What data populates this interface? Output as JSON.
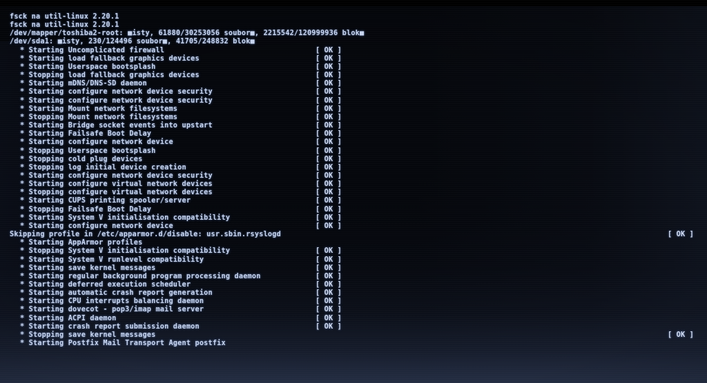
{
  "screen": {
    "kind": "linux-boot-console",
    "background_color": "#05070c",
    "text_color": "#c7d4ee",
    "status_ok_color": "#d2dcf2"
  },
  "console": {
    "lines": [
      {
        "text": "fsck na util-linux 2.20.1",
        "indent": false,
        "status": "",
        "status_pos": ""
      },
      {
        "text": "fsck na util-linux 2.20.1",
        "indent": false,
        "status": "",
        "status_pos": ""
      },
      {
        "text": "/dev/mapper/toshiba2-root: ■isty, 61880/30253056 soubor■, 2215542/120999936 blok■",
        "indent": false,
        "status": "",
        "status_pos": ""
      },
      {
        "text": "/dev/sda1: ■isty, 230/124496 soubor■, 41705/248832 blok■",
        "indent": false,
        "status": "",
        "status_pos": ""
      },
      {
        "text": "* Starting Uncomplicated firewall",
        "indent": true,
        "status": "[ OK ]",
        "status_pos": "near"
      },
      {
        "text": "* Starting load fallback graphics devices",
        "indent": true,
        "status": "[ OK ]",
        "status_pos": "near"
      },
      {
        "text": "* Starting Userspace bootsplash",
        "indent": true,
        "status": "[ OK ]",
        "status_pos": "near"
      },
      {
        "text": "* Stopping load fallback graphics devices",
        "indent": true,
        "status": "[ OK ]",
        "status_pos": "near"
      },
      {
        "text": "* Starting mDNS/DNS-SD daemon",
        "indent": true,
        "status": "[ OK ]",
        "status_pos": "near"
      },
      {
        "text": "* Starting configure network device security",
        "indent": true,
        "status": "[ OK ]",
        "status_pos": "near"
      },
      {
        "text": "* Starting configure network device security",
        "indent": true,
        "status": "[ OK ]",
        "status_pos": "near"
      },
      {
        "text": "* Starting Mount network filesystems",
        "indent": true,
        "status": "[ OK ]",
        "status_pos": "near"
      },
      {
        "text": "* Stopping Mount network filesystems",
        "indent": true,
        "status": "[ OK ]",
        "status_pos": "near"
      },
      {
        "text": "* Starting Bridge socket events into upstart",
        "indent": true,
        "status": "[ OK ]",
        "status_pos": "near"
      },
      {
        "text": "* Starting Failsafe Boot Delay",
        "indent": true,
        "status": "[ OK ]",
        "status_pos": "near"
      },
      {
        "text": "* Starting configure network device",
        "indent": true,
        "status": "[ OK ]",
        "status_pos": "near"
      },
      {
        "text": "* Stopping Userspace bootsplash",
        "indent": true,
        "status": "[ OK ]",
        "status_pos": "near"
      },
      {
        "text": "* Stopping cold plug devices",
        "indent": true,
        "status": "[ OK ]",
        "status_pos": "near"
      },
      {
        "text": "* Stopping log initial device creation",
        "indent": true,
        "status": "[ OK ]",
        "status_pos": "near"
      },
      {
        "text": "* Starting configure network device security",
        "indent": true,
        "status": "[ OK ]",
        "status_pos": "near"
      },
      {
        "text": "* Starting configure virtual network devices",
        "indent": true,
        "status": "[ OK ]",
        "status_pos": "near"
      },
      {
        "text": "* Stopping configure virtual network devices",
        "indent": true,
        "status": "[ OK ]",
        "status_pos": "near"
      },
      {
        "text": "* Starting CUPS printing spooler/server",
        "indent": true,
        "status": "[ OK ]",
        "status_pos": "near"
      },
      {
        "text": "* Stopping Failsafe Boot Delay",
        "indent": true,
        "status": "[ OK ]",
        "status_pos": "near"
      },
      {
        "text": "* Starting System V initialisation compatibility",
        "indent": true,
        "status": "[ OK ]",
        "status_pos": "near"
      },
      {
        "text": "* Starting configure network device",
        "indent": true,
        "status": "[ OK ]",
        "status_pos": "near"
      },
      {
        "text": "Skipping profile in /etc/apparmor.d/disable: usr.sbin.rsyslogd",
        "indent": false,
        "status": "[ OK ]",
        "status_pos": "far"
      },
      {
        "text": "* Starting AppArmor profiles",
        "indent": true,
        "status": "",
        "status_pos": ""
      },
      {
        "text": "* Stopping System V initialisation compatibility",
        "indent": true,
        "status": "[ OK ]",
        "status_pos": "near"
      },
      {
        "text": "* Starting System V runlevel compatibility",
        "indent": true,
        "status": "[ OK ]",
        "status_pos": "near"
      },
      {
        "text": "* Starting save kernel messages",
        "indent": true,
        "status": "[ OK ]",
        "status_pos": "near"
      },
      {
        "text": "* Starting regular background program processing daemon",
        "indent": true,
        "status": "[ OK ]",
        "status_pos": "near"
      },
      {
        "text": "* Starting deferred execution scheduler",
        "indent": true,
        "status": "[ OK ]",
        "status_pos": "near"
      },
      {
        "text": "* Starting automatic crash report generation",
        "indent": true,
        "status": "[ OK ]",
        "status_pos": "near"
      },
      {
        "text": "* Starting CPU interrupts balancing daemon",
        "indent": true,
        "status": "[ OK ]",
        "status_pos": "near"
      },
      {
        "text": "* Starting dovecot - pop3/imap mail server",
        "indent": true,
        "status": "[ OK ]",
        "status_pos": "near"
      },
      {
        "text": "* Starting ACPI daemon",
        "indent": true,
        "status": "[ OK ]",
        "status_pos": "near"
      },
      {
        "text": "* Starting crash report submission daemon",
        "indent": true,
        "status": "[ OK ]",
        "status_pos": "near"
      },
      {
        "text": "* Stopping save kernel messages",
        "indent": true,
        "status": "[ OK ]",
        "status_pos": "far"
      },
      {
        "text": "* Starting Postfix Mail Transport Agent postfix",
        "indent": true,
        "status": "",
        "status_pos": ""
      }
    ]
  }
}
